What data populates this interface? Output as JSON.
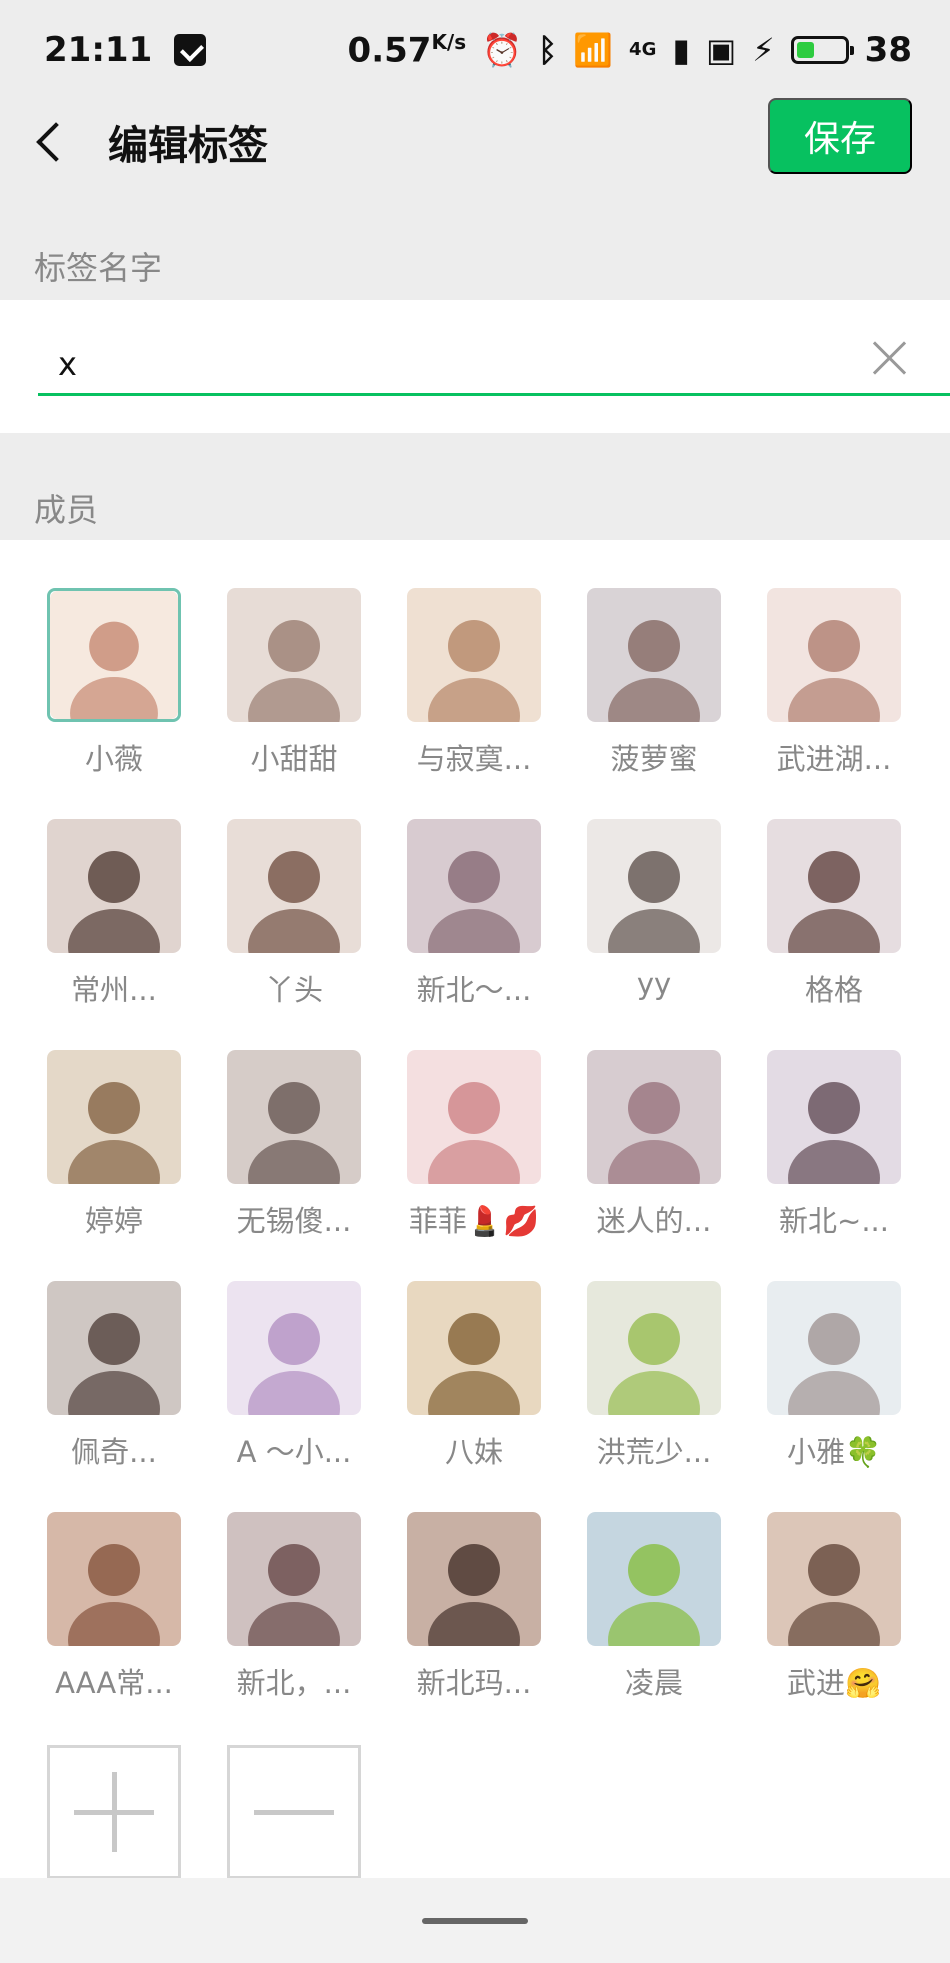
{
  "status_bar": {
    "time": "21:11",
    "speed": "0.57",
    "speed_unit": "K/s",
    "network": "4G",
    "battery_level": "38",
    "battery_fraction": 0.38
  },
  "nav": {
    "title": "编辑标签",
    "save_label": "保存"
  },
  "tag_section": {
    "label": "标签名字",
    "value": "x"
  },
  "members_section": {
    "label": "成员",
    "members": [
      {
        "name": "小薇"
      },
      {
        "name": "小甜甜"
      },
      {
        "name": "与寂寞..."
      },
      {
        "name": "菠萝蜜"
      },
      {
        "name": "武进湖..."
      },
      {
        "name": "常州..."
      },
      {
        "name": "丫头"
      },
      {
        "name": "新北～..."
      },
      {
        "name": "yy"
      },
      {
        "name": "格格"
      },
      {
        "name": "婷婷"
      },
      {
        "name": "无锡傻..."
      },
      {
        "name": "菲菲💄💋"
      },
      {
        "name": "迷人的..."
      },
      {
        "name": "新北~..."
      },
      {
        "name": "佩奇..."
      },
      {
        "name": "A ～小..."
      },
      {
        "name": "八妹"
      },
      {
        "name": "洪荒少..."
      },
      {
        "name": "小雅🍀"
      },
      {
        "name": "AAA常..."
      },
      {
        "name": "新北，..."
      },
      {
        "name": "新北玛..."
      },
      {
        "name": "凌晨"
      },
      {
        "name": "武进🤗"
      }
    ]
  }
}
